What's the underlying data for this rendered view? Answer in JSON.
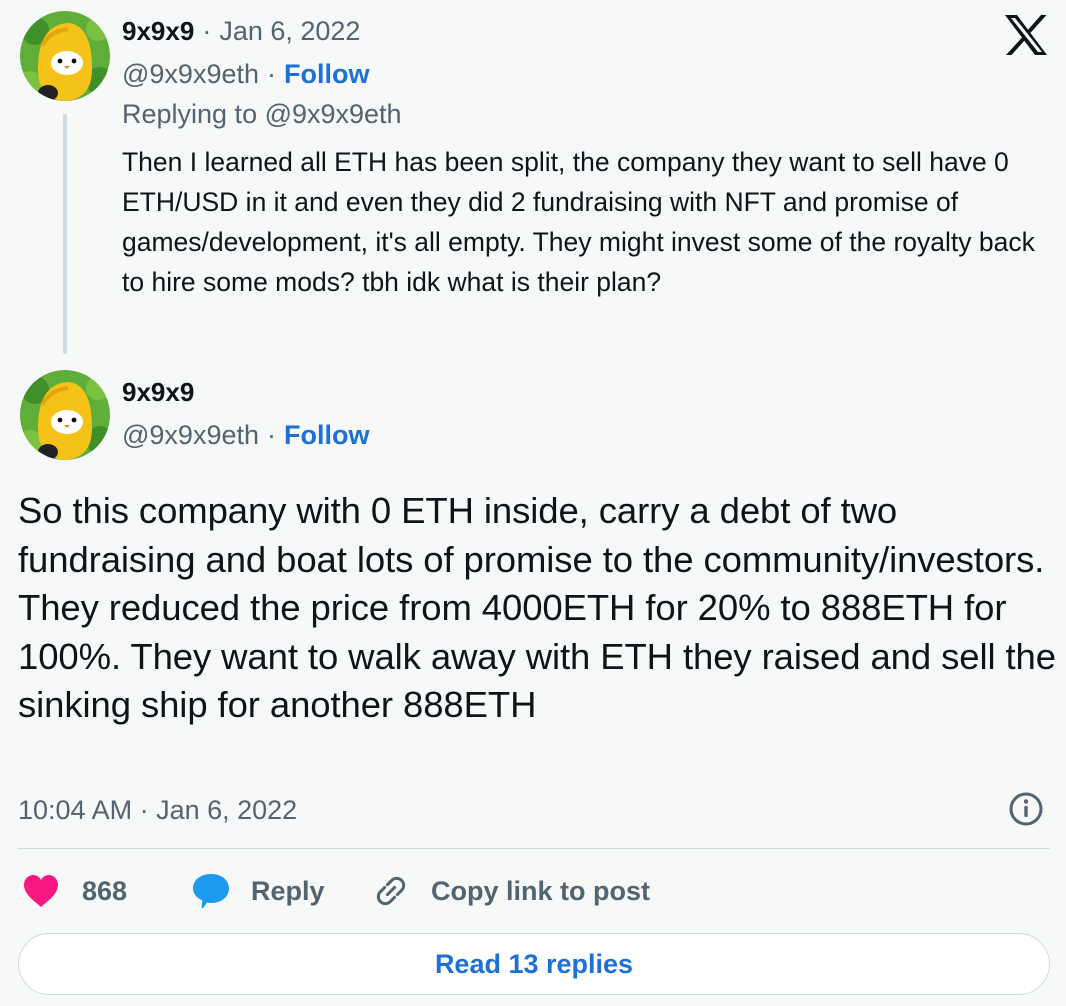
{
  "reply_tweet": {
    "author_name": "9x9x9",
    "separator": "·",
    "date": "Jan 6, 2022",
    "handle": "@9x9x9eth",
    "follow_label": "Follow",
    "replying_to": "Replying to @9x9x9eth",
    "text": "Then I learned all ETH has been split, the company they want to sell have 0 ETH/USD in it and even they did 2 fundraising with NFT and promise of games/development, it's all empty. They might invest some of the royalty back to hire some mods? tbh idk what is their plan?"
  },
  "main_tweet": {
    "author_name": "9x9x9",
    "handle": "@9x9x9eth",
    "separator": "·",
    "follow_label": "Follow",
    "text": "So this company with 0 ETH inside, carry a debt of two fundraising and boat lots of promise to the community/investors. They reduced the price from 4000ETH for 20% to 888ETH for 100%. They want to walk away with ETH they raised and sell the sinking ship for another 888ETH",
    "timestamp": "10:04 AM · Jan 6, 2022"
  },
  "actions": {
    "like_count": "868",
    "reply_label": "Reply",
    "copy_label": "Copy link to post"
  },
  "read_replies_label": "Read 13 replies",
  "icons": {
    "logo": "x-logo-icon",
    "info": "info-icon",
    "like": "heart-icon",
    "reply": "speech-bubble-icon",
    "copy": "link-icon"
  },
  "colors": {
    "background": "#f7f9f9",
    "accent": "#1d70d6",
    "like": "#f91880",
    "muted": "#536471",
    "text": "#0f1419"
  }
}
